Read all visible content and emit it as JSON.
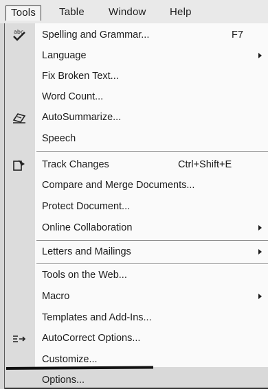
{
  "menubar": {
    "items": [
      {
        "label": "Tools"
      },
      {
        "label": "Table"
      },
      {
        "label": "Window"
      },
      {
        "label": "Help"
      }
    ]
  },
  "menu": {
    "items": [
      {
        "label": "Spelling and Grammar...",
        "shortcut": "F7",
        "icon": "spelling-abc-check-icon"
      },
      {
        "label": "Language",
        "submenu": true
      },
      {
        "label": "Fix Broken Text..."
      },
      {
        "label": "Word Count..."
      },
      {
        "label": "AutoSummarize...",
        "icon": "autosummarize-icon"
      },
      {
        "label": "Speech"
      },
      {
        "label": "Track Changes",
        "shortcut": "Ctrl+Shift+E",
        "icon": "track-changes-icon"
      },
      {
        "label": "Compare and Merge Documents..."
      },
      {
        "label": "Protect Document..."
      },
      {
        "label": "Online Collaboration",
        "submenu": true
      },
      {
        "label": "Letters and Mailings",
        "submenu": true
      },
      {
        "label": "Tools on the Web..."
      },
      {
        "label": "Macro",
        "submenu": true
      },
      {
        "label": "Templates and Add-Ins..."
      },
      {
        "label": "AutoCorrect Options...",
        "icon": "autocorrect-icon"
      },
      {
        "label": "Customize..."
      },
      {
        "label": "Options..."
      }
    ]
  }
}
